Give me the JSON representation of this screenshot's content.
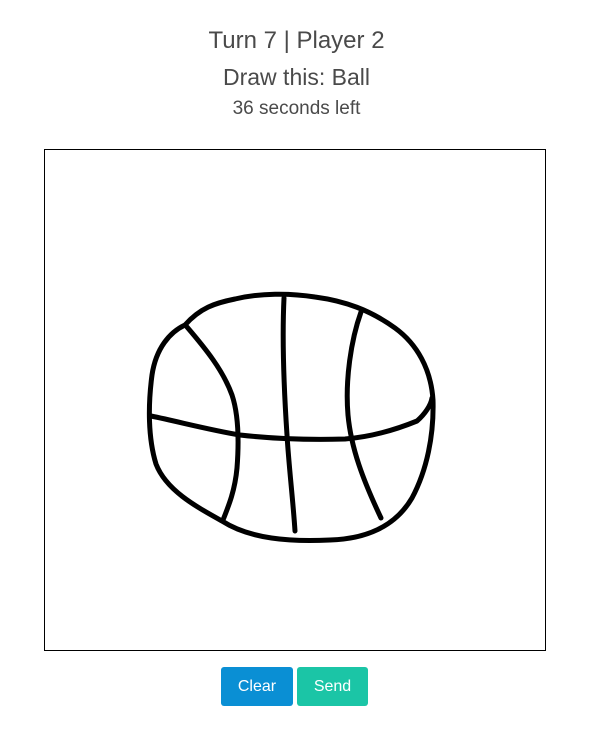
{
  "header": {
    "turn_text": "Turn 7 | Player 2",
    "prompt_text": "Draw this: Ball",
    "timer_text": "36 seconds left"
  },
  "canvas": {
    "current_drawing": "ball sketch",
    "stroke_color": "#000000",
    "background_color": "#ffffff"
  },
  "actions": {
    "clear_label": "Clear",
    "send_label": "Send"
  },
  "colors": {
    "clear_button": "#0a8fd4",
    "send_button": "#1bc5a6",
    "text": "#4a4a4a"
  }
}
